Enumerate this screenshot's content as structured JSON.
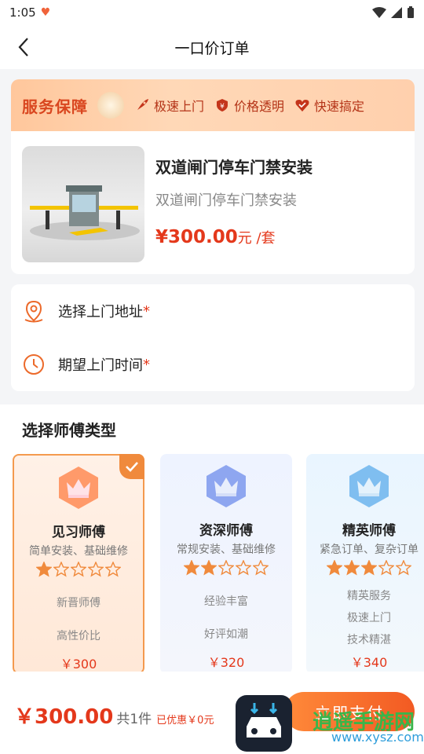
{
  "status": {
    "time": "1:05"
  },
  "header": {
    "title": "一口价订单"
  },
  "banner": {
    "brand": "服务保障",
    "features": [
      "极速上门",
      "价格透明",
      "快速搞定"
    ]
  },
  "product": {
    "name": "双道闸门停车门禁安装",
    "subtitle": "双道闸门停车门禁安装",
    "price": "¥300.00",
    "unit": "元 /套"
  },
  "form": {
    "address_label": "选择上门地址",
    "time_label": "期望上门时间",
    "required_mark": "*"
  },
  "masters": {
    "section_title": "选择师傅类型",
    "items": [
      {
        "name": "见习师傅",
        "desc": "简单安装、基础维修",
        "rating": 1,
        "tags": [
          "新晋师傅",
          "高性价比"
        ],
        "price": "￥300",
        "selected": true
      },
      {
        "name": "资深师傅",
        "desc": "常规安装、基础维修",
        "rating": 2,
        "tags": [
          "经验丰富",
          "好评如潮"
        ],
        "price": "￥320",
        "selected": false
      },
      {
        "name": "精英师傅",
        "desc": "紧急订单、复杂订单",
        "rating": 3,
        "tags": [
          "精英服务",
          "极速上门",
          "技术精湛"
        ],
        "price": "￥340",
        "selected": false
      }
    ],
    "max_rating": 5
  },
  "bottom": {
    "total": "￥300.00",
    "count": "共1件",
    "discount": "已优惠￥0元",
    "pay_label": "立即支付"
  },
  "watermark": {
    "title": "逍遥手游网",
    "url": "www.xysz.com"
  },
  "colors": {
    "accent": "#e4381b",
    "orange": "#f08a3c",
    "banner": "#ffc79c"
  }
}
